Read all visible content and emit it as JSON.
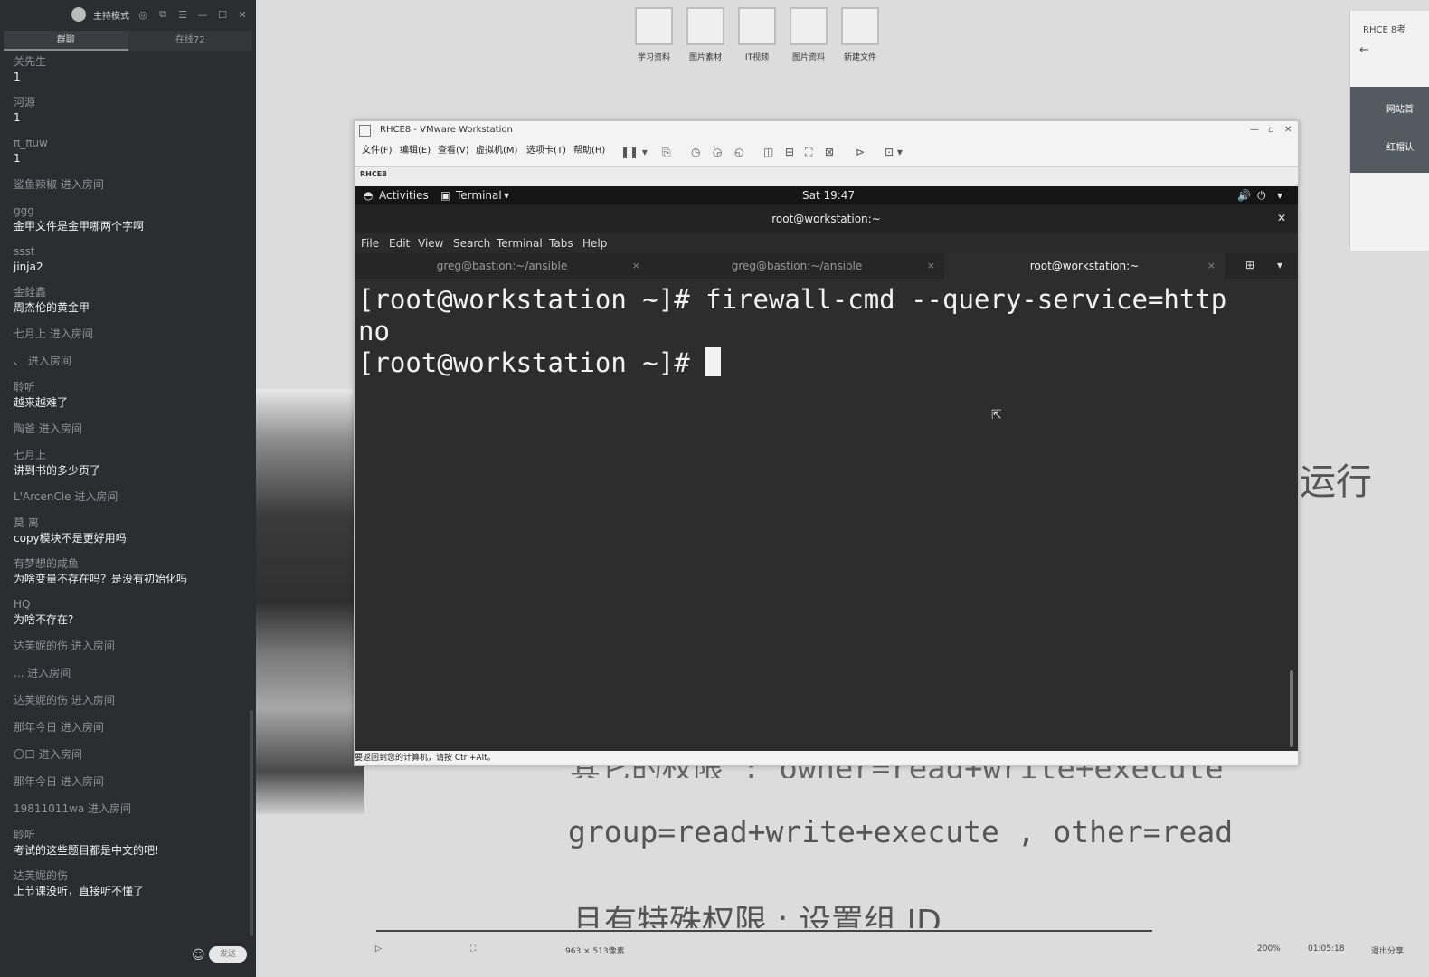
{
  "chat": {
    "title": "主持模式",
    "tabs": [
      "群聊",
      "在线72"
    ],
    "messages": [
      {
        "user": "关先生",
        "text": "1"
      },
      {
        "user": "河源",
        "text": "1"
      },
      {
        "user": "π_πuw",
        "text": "1"
      },
      {
        "join": "鲨鱼辣椒 进入房间"
      },
      {
        "user": "ggg",
        "text": "金甲文件是金甲哪两个字啊"
      },
      {
        "user": "ssst",
        "text": "jinja2"
      },
      {
        "user": "金銓鑫",
        "text": "周杰伦的黄金甲"
      },
      {
        "join": "七月上 进入房间"
      },
      {
        "join": "、 进入房间"
      },
      {
        "user": "聆听",
        "text": "越来越难了"
      },
      {
        "join": "陶爸 进入房间"
      },
      {
        "user": "七月上",
        "text": "讲到书的多少页了"
      },
      {
        "join": "L'ArcenCie 进入房间"
      },
      {
        "user": "莫 离",
        "text": "copy模块不是更好用吗"
      },
      {
        "user": "有梦想的咸鱼",
        "text": "为啥变量不存在吗？是没有初始化吗"
      },
      {
        "user": "HQ",
        "text": "为啥不存在?"
      },
      {
        "join": "达芙妮的伤 进入房间"
      },
      {
        "join": "           ... 进入房间"
      },
      {
        "join": "达芙妮的伤 进入房间"
      },
      {
        "join": "那年今日 进入房间"
      },
      {
        "join": "〇口 进入房间"
      },
      {
        "join": "那年今日 进入房间"
      },
      {
        "join": "19811011wa 进入房间"
      },
      {
        "user": "聆听",
        "text": "考试的这些题目都是中文的吧!"
      },
      {
        "user": "达芙妮的伤",
        "text": "上节课没听，直接听不懂了"
      }
    ],
    "send_label": "发送"
  },
  "desktop": {
    "icons": [
      "学习资料",
      "图片素材",
      "IT视频",
      "图片资料",
      "新建文件"
    ],
    "right_window": {
      "title": "RHCE 8考",
      "back": "←",
      "item1": "网站首",
      "item2": "红帽认"
    },
    "slide": {
      "line0": "运行",
      "line1": "其它的权限 : owner=read+write+execute",
      "line2": "group=read+write+execute , other=read",
      "line3": "且有特殊权限 : 设置组 ID"
    },
    "bottom": {
      "resolution": "963 × 513像素",
      "zoom": "200%",
      "timer": "01:05:18",
      "exit": "退出分享"
    }
  },
  "vmware": {
    "title": "RHCE8 - VMware Workstation",
    "menus": [
      "文件(F)",
      "编辑(E)",
      "查看(V)",
      "虚拟机(M)",
      "选项卡(T)",
      "帮助(H)"
    ],
    "vm_tab": "RHCE8",
    "status": "要返回到您的计算机，请按 Ctrl+Alt。"
  },
  "gnome": {
    "activities": "Activities",
    "app": "Terminal",
    "clock": "Sat 19:47"
  },
  "terminal": {
    "title": "root@workstation:~",
    "menu": [
      "File",
      "Edit",
      "View",
      "Search",
      "Terminal",
      "Tabs",
      "Help"
    ],
    "tabs": [
      "greg@bastion:~/ansible",
      "greg@bastion:~/ansible",
      "root@workstation:~"
    ],
    "lines": [
      "[root@workstation ~]# firewall-cmd --query-service=http",
      "no",
      "[root@workstation ~]# "
    ]
  }
}
